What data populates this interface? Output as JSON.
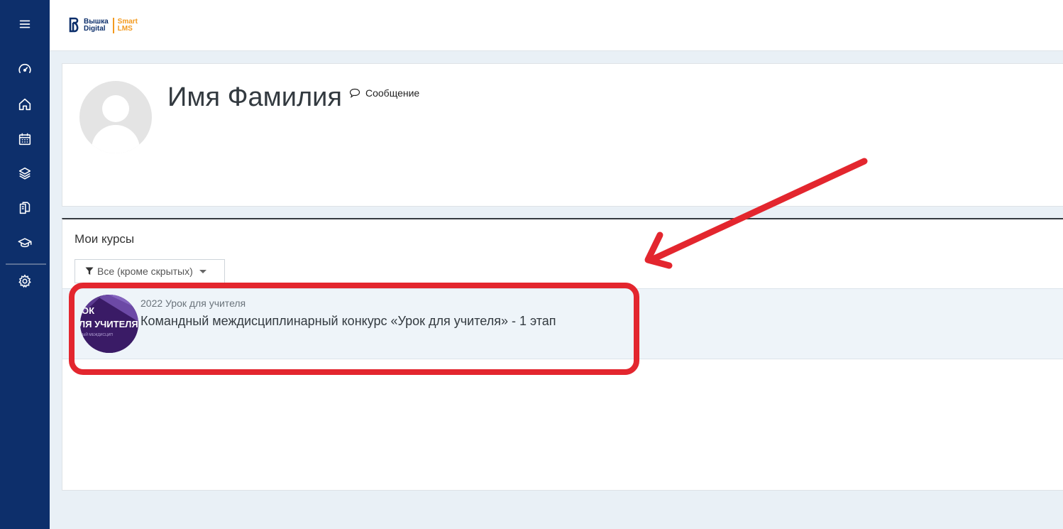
{
  "sidebar": {
    "menu_icon": "hamburger-menu-icon",
    "items": [
      {
        "name": "dashboard",
        "icon": "speedometer-icon"
      },
      {
        "name": "home",
        "icon": "home-icon"
      },
      {
        "name": "calendar",
        "icon": "calendar-icon"
      },
      {
        "name": "courses",
        "icon": "layers-icon"
      },
      {
        "name": "files",
        "icon": "documents-icon"
      },
      {
        "name": "grades",
        "icon": "graduation-cap-icon"
      }
    ],
    "settings_icon": "gear-icon",
    "colors": {
      "background": "#0d2f6b",
      "icon": "#ffffff"
    }
  },
  "header": {
    "logo_line1": "Вышка",
    "logo_line2": "Digital",
    "logo_line3": "Smart",
    "logo_line4": "LMS",
    "colors": {
      "brand": "#0d2f6b",
      "accent": "#f39a1f"
    }
  },
  "profile": {
    "name": "Имя Фамилия",
    "message_label": "Сообщение"
  },
  "courses": {
    "title": "Мои курсы",
    "filter_label": "Все (кроме скрытых)",
    "items": [
      {
        "category": "2022 Урок для учителя",
        "name": "Командный междисциплинарный конкурс «Урок для учителя» - 1 этап",
        "image_line1": "ОК",
        "image_line2": "ЛЯ УЧИТЕЛЯ",
        "image_line3": "ДНЫЙ МЕЖДИСЦИП"
      }
    ]
  },
  "annotation": {
    "color": "#e3262e"
  }
}
